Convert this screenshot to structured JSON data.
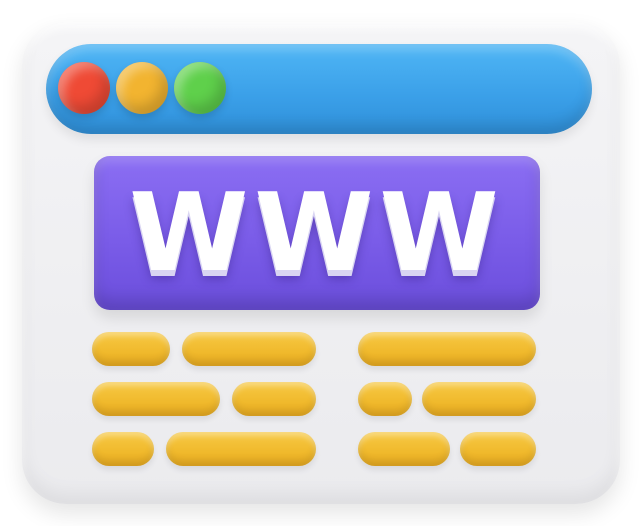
{
  "banner": {
    "text": "WWW"
  },
  "window_controls": {
    "close_color": "#ef4a35",
    "minimize_color": "#f2b430",
    "maximize_color": "#5fd04b"
  },
  "colors": {
    "titlebar": "#3a9fe8",
    "banner": "#7a5ce8",
    "text_bars": "#f0b92c",
    "window": "#f0f0f2"
  },
  "icons": [
    "browser-window-icon",
    "www-globe-icon"
  ]
}
